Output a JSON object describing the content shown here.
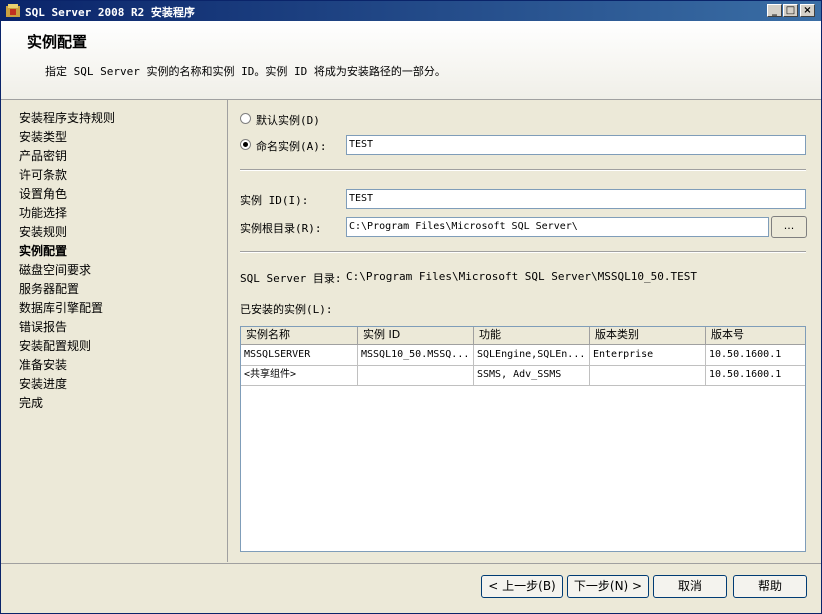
{
  "window": {
    "title": "SQL Server 2008 R2 安装程序",
    "minimize_glyph": "_",
    "maximize_glyph": "□",
    "close_glyph": "×"
  },
  "header": {
    "title": "实例配置",
    "description": "指定 SQL Server 实例的名称和实例 ID。实例 ID 将成为安装路径的一部分。"
  },
  "sidebar": {
    "items": [
      {
        "label": "安装程序支持规则"
      },
      {
        "label": "安装类型"
      },
      {
        "label": "产品密钥"
      },
      {
        "label": "许可条款"
      },
      {
        "label": "设置角色"
      },
      {
        "label": "功能选择"
      },
      {
        "label": "安装规则"
      },
      {
        "label": "实例配置",
        "active": true
      },
      {
        "label": "磁盘空间要求"
      },
      {
        "label": "服务器配置"
      },
      {
        "label": "数据库引擎配置"
      },
      {
        "label": "错误报告"
      },
      {
        "label": "安装配置规则"
      },
      {
        "label": "准备安装"
      },
      {
        "label": "安装进度"
      },
      {
        "label": "完成"
      }
    ]
  },
  "form": {
    "default_instance_label": "默认实例(D)",
    "default_instance_selected": false,
    "named_instance_label": "命名实例(A):",
    "named_instance_selected": true,
    "named_instance_value": "TEST",
    "instance_id_label": "实例 ID(I):",
    "instance_id_value": "TEST",
    "instance_root_label": "实例根目录(R):",
    "instance_root_value": "C:\\Program Files\\Microsoft SQL Server\\",
    "browse_label": "...",
    "sql_dir_label": "SQL Server 目录:",
    "sql_dir_value": "C:\\Program Files\\Microsoft SQL Server\\MSSQL10_50.TEST",
    "installed_label": "已安装的实例(L):"
  },
  "table": {
    "columns": [
      "实例名称",
      "实例 ID",
      "功能",
      "版本类别",
      "版本号"
    ],
    "rows": [
      [
        "MSSQLSERVER",
        "MSSQL10_50.MSSQ...",
        "SQLEngine,SQLEn...",
        "Enterprise",
        "10.50.1600.1"
      ],
      [
        "<共享组件>",
        "",
        "SSMS, Adv_SSMS",
        "",
        "10.50.1600.1"
      ]
    ]
  },
  "footer": {
    "back_label": "< 上一步(B)",
    "next_label": "下一步(N) >",
    "cancel_label": "取消",
    "help_label": "帮助"
  }
}
